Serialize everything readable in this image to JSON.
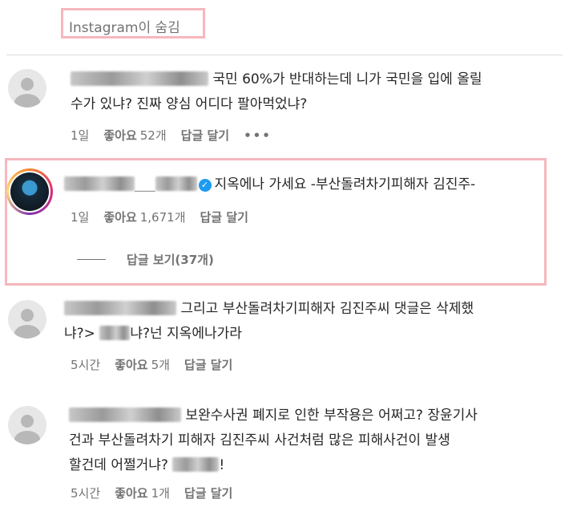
{
  "hidden_label": "Instagram이 숨김",
  "comments": [
    {
      "text_line1": "국민 60%가 반대하는데 니가 국민을 입에 올릴",
      "text_line2": "수가 있냐? 진짜 양심 어디다 팔아먹었냐?",
      "time": "1일",
      "like_label": "좋아요",
      "like_count": "52개",
      "reply": "답글 달기",
      "more": "•••"
    },
    {
      "username": "___",
      "text_line1": "지옥에나 가세요 -부산돌려차기피해자 김진주-",
      "time": "1일",
      "like_label": "좋아요",
      "like_count": "1,671개",
      "reply": "답글 달기",
      "view_replies": "답글 보기(37개)"
    },
    {
      "text_line1": "그리고 부산돌려차기피해자 김진주씨 댓글은 삭제했",
      "text_line2a": "냐?>",
      "text_line2b": "냐?넌 지옥에나가라",
      "time": "5시간",
      "like_label": "좋아요",
      "like_count": "5개",
      "reply": "답글 달기"
    },
    {
      "text_line1": "보완수사권 폐지로 인한 부작용은 어쩌고? 장윤기사",
      "text_line2": "건과 부산돌려차기 피해자 김진주씨 사건처럼 많은 피해사건이 발생",
      "text_line3a": "할건데 어쩔거냐?",
      "text_line3b": "!",
      "time": "5시간",
      "like_label": "좋아요",
      "like_count": "1개",
      "reply": "답글 달기"
    }
  ],
  "colors": {
    "highlight_border": "#f7b7bd",
    "verified": "#1d9bf0",
    "muted_text": "#737373"
  }
}
